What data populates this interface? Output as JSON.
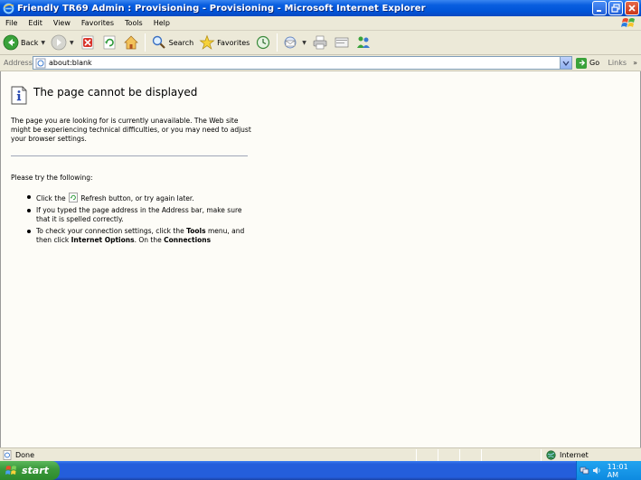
{
  "window": {
    "title": "Friendly TR69 Admin : Provisioning - Provisioning - Microsoft Internet Explorer"
  },
  "menu": [
    "File",
    "Edit",
    "View",
    "Favorites",
    "Tools",
    "Help"
  ],
  "toolbar": {
    "back_label": "Back",
    "search_label": "Search",
    "favorites_label": "Favorites"
  },
  "address": {
    "label": "Address",
    "value": "about:blank",
    "go_label": "Go",
    "links_label": "Links"
  },
  "page": {
    "heading": "The page cannot be displayed",
    "description": "The page you are looking for is currently unavailable. The Web site might be experiencing technical difficulties, or you may need to adjust your browser settings.",
    "try_label": "Please try the following:",
    "bullet1_a": "Click the",
    "bullet1_b": "Refresh button, or try again later.",
    "bullet2": "If you typed the page address in the Address bar, make sure that it is spelled correctly.",
    "bullet3_a": "To check your connection settings, click the",
    "bullet3_tools": "Tools",
    "bullet3_b": "menu, and then click",
    "bullet3_options": "Internet Options",
    "bullet3_c": ". On the",
    "bullet3_connections": "Connections"
  },
  "status": {
    "text": "Done",
    "zone": "Internet"
  },
  "taskbar": {
    "start_label": "start",
    "clock": "11:01 AM"
  }
}
